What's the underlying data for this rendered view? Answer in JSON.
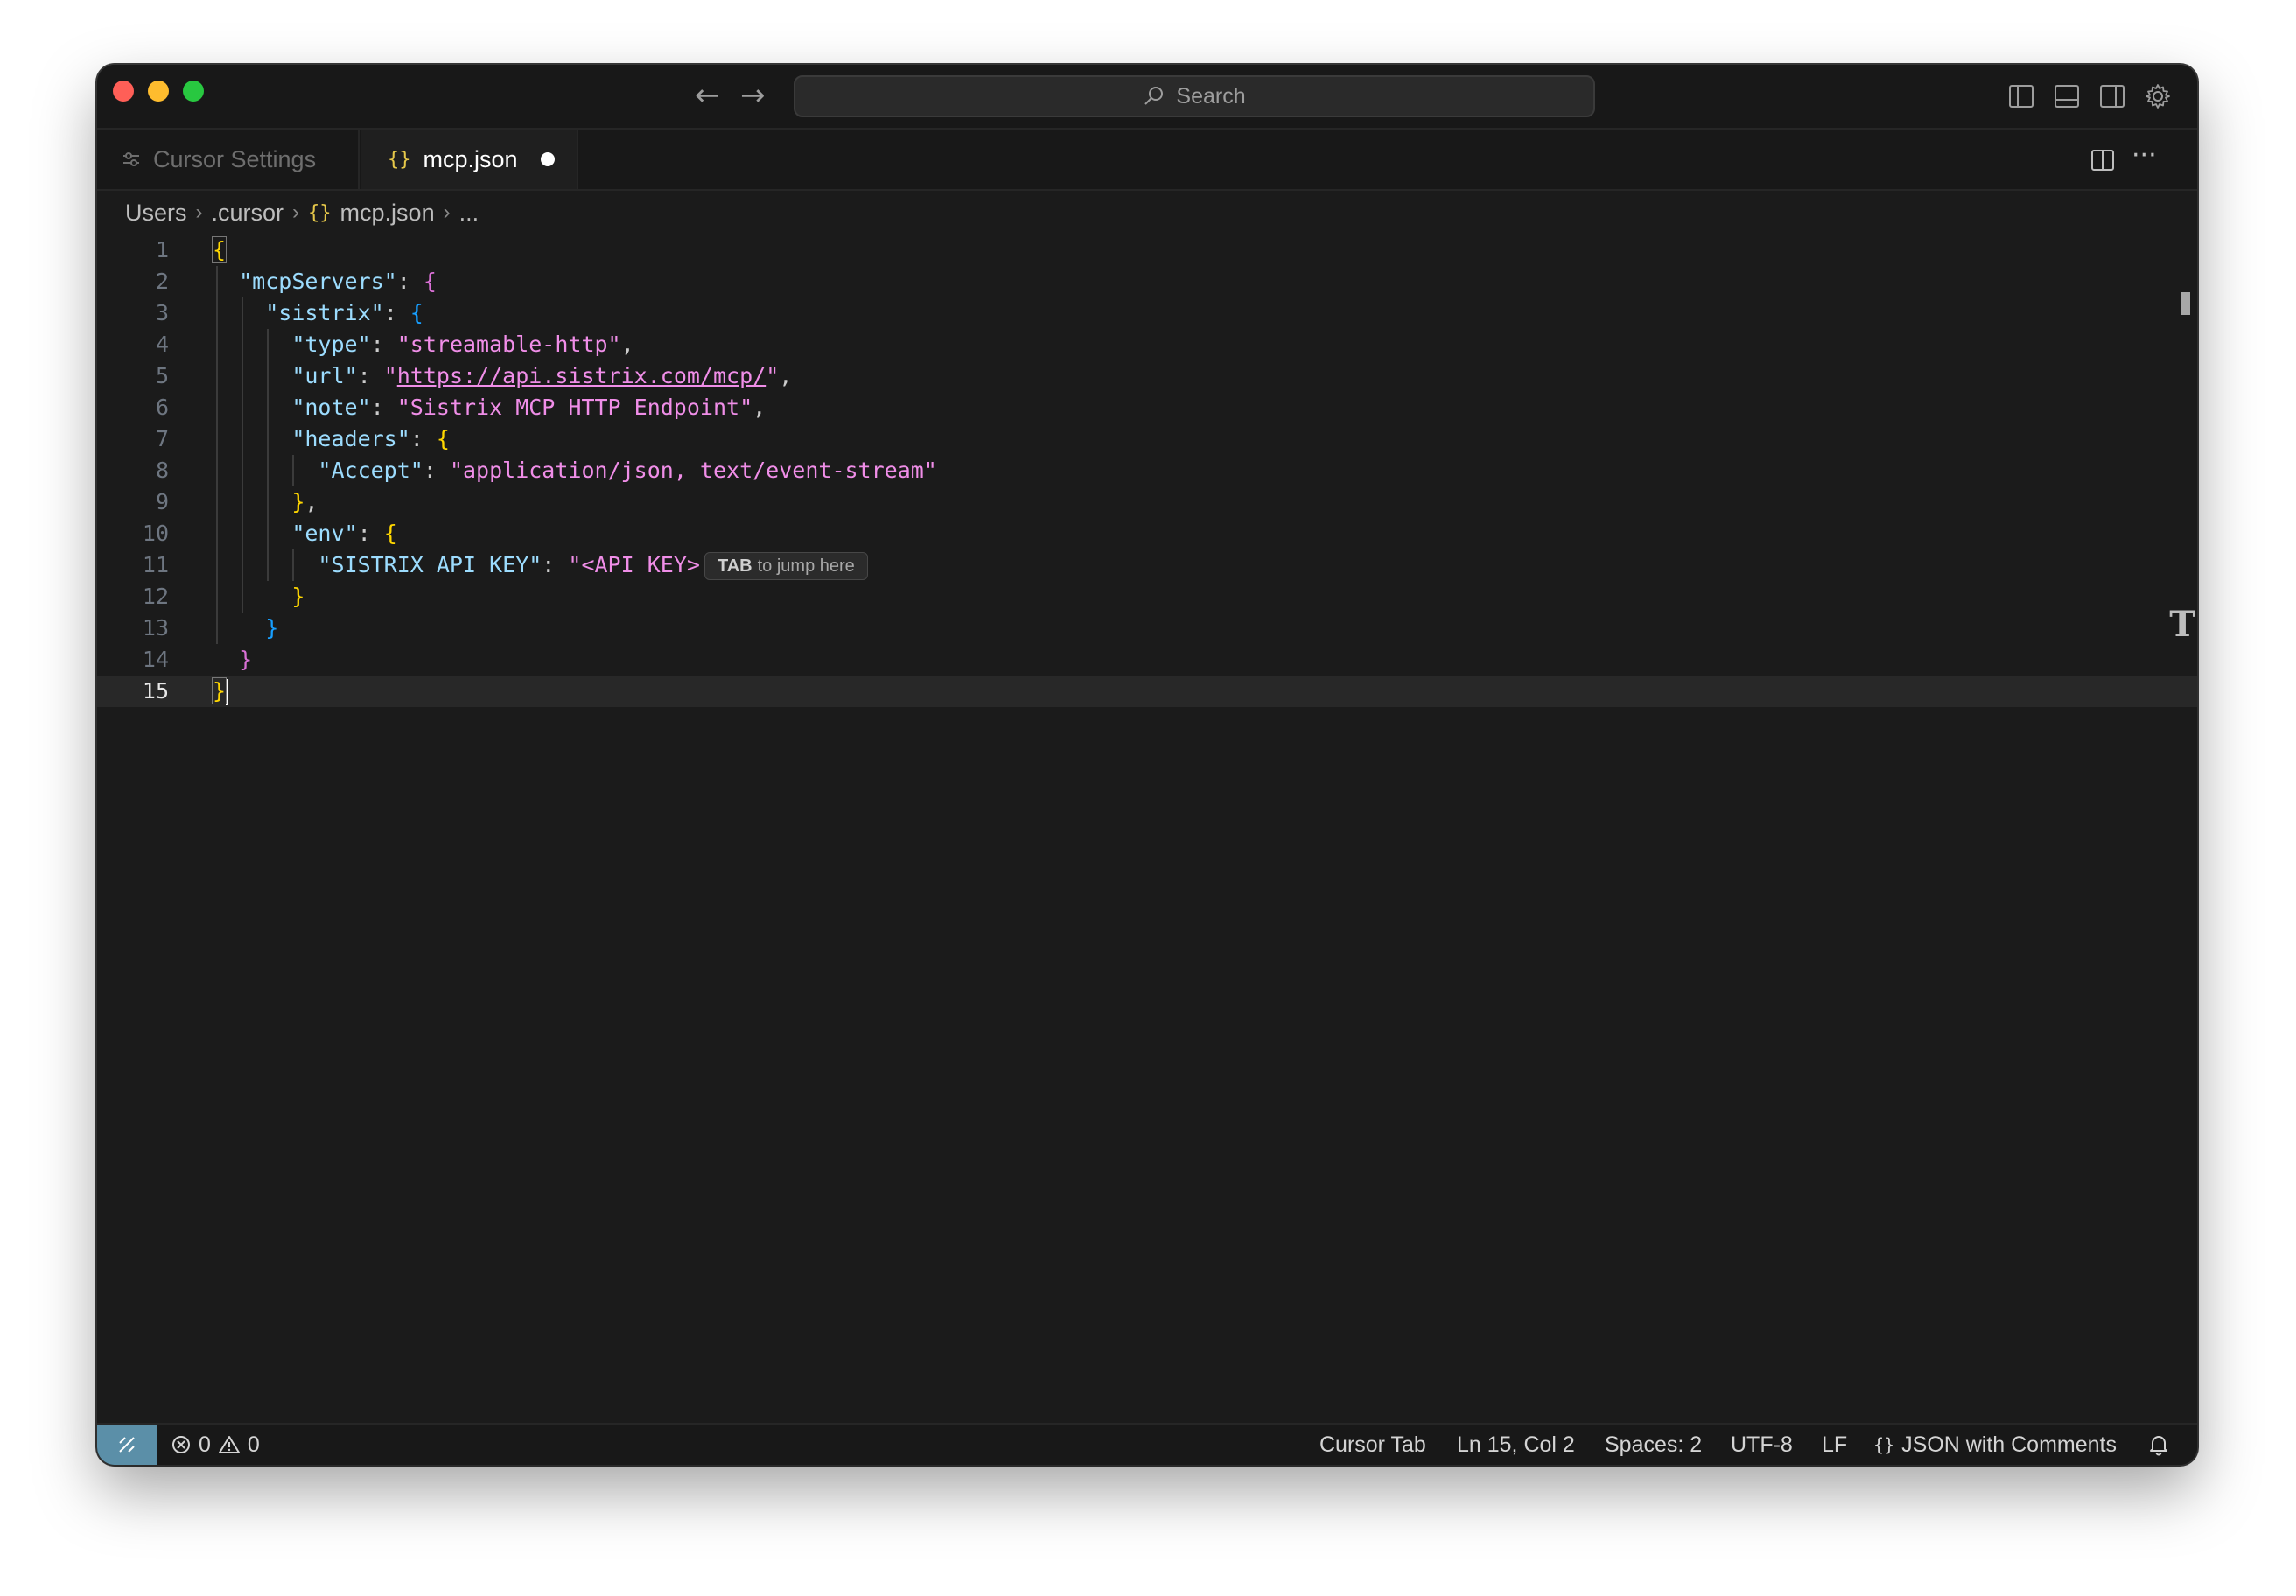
{
  "titlebar": {
    "search_placeholder": "Search"
  },
  "tabs": [
    {
      "label": "Cursor Settings",
      "active": false
    },
    {
      "label": "mcp.json",
      "active": true,
      "icon": "{}",
      "modified": true
    }
  ],
  "breadcrumb": {
    "items": [
      "Users",
      ".cursor",
      "mcp.json",
      "..."
    ],
    "file_icon": "{}"
  },
  "editor": {
    "current_line": 15,
    "line_numbers": [
      "1",
      "2",
      "3",
      "4",
      "5",
      "6",
      "7",
      "8",
      "9",
      "10",
      "11",
      "12",
      "13",
      "14",
      "15"
    ],
    "lines": [
      "{",
      "  \"mcpServers\": {",
      "    \"sistrix\": {",
      "      \"type\": \"streamable-http\",",
      "      \"url\": \"https://api.sistrix.com/mcp/\",",
      "      \"note\": \"Sistrix MCP HTTP Endpoint\",",
      "      \"headers\": {",
      "        \"Accept\": \"application/json, text/event-stream\"",
      "      },",
      "      \"env\": {",
      "        \"SISTRIX_API_KEY\": \"<API_KEY>\"",
      "      }",
      "    }",
      "  }",
      "}"
    ],
    "tokens": {
      "k_mcpServers": "\"mcpServers\"",
      "k_sistrix": "\"sistrix\"",
      "k_type": "\"type\"",
      "v_type": "\"streamable-http\"",
      "k_url": "\"url\"",
      "v_url_q": "\"",
      "v_url": "https://api.sistrix.com/mcp/",
      "k_note": "\"note\"",
      "v_note": "\"Sistrix MCP HTTP Endpoint\"",
      "k_headers": "\"headers\"",
      "k_accept": "\"Accept\"",
      "v_accept": "\"application/json, text/event-stream\"",
      "k_env": "\"env\"",
      "k_apikey": "\"SISTRIX_API_KEY\"",
      "v_apikey": "\"<API_KEY>\""
    },
    "tab_hint": {
      "key": "TAB",
      "text": "to jump here"
    }
  },
  "statusbar": {
    "errors": "0",
    "warnings": "0",
    "cursor_tab": "Cursor Tab",
    "position": "Ln 15, Col 2",
    "spaces": "Spaces: 2",
    "encoding": "UTF-8",
    "eol": "LF",
    "language": "JSON with Comments",
    "language_icon": "{}"
  },
  "colors": {
    "background": "#1b1b1b",
    "remote_indicator": "#5b8fa8",
    "json_key": "#9cdcfe",
    "json_string": "#f08ee8",
    "bracket_level1": "#ffd700",
    "bracket_level2": "#da70d6",
    "bracket_level3": "#179fff"
  }
}
